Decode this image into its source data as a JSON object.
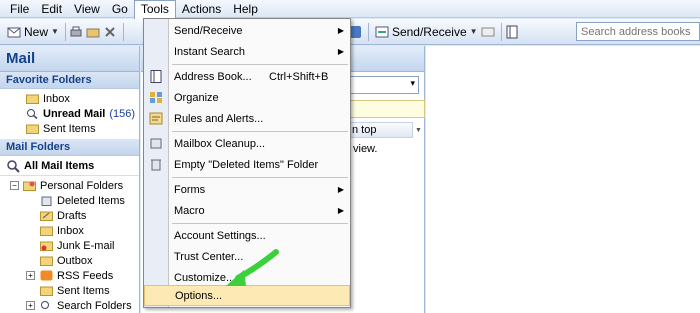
{
  "menubar": {
    "items": [
      "File",
      "Edit",
      "View",
      "Go",
      "Tools",
      "Actions",
      "Help"
    ]
  },
  "toolbar": {
    "new_label": "New",
    "send_receive_label": "Send/Receive",
    "search_placeholder": "Search address books"
  },
  "nav": {
    "title": "Mail",
    "favorites_header": "Favorite Folders",
    "favorites": [
      {
        "label": "Inbox"
      },
      {
        "label": "Unread Mail",
        "count": "(156)"
      },
      {
        "label": "Sent Items"
      }
    ],
    "mail_folders_header": "Mail Folders",
    "all_mail_label": "All Mail Items",
    "personal_folders_label": "Personal Folders",
    "folders": [
      "Deleted Items",
      "Drafts",
      "Inbox",
      "Junk E-mail",
      "Outbox",
      "RSS Feeds",
      "Sent Items",
      "Search Folders"
    ]
  },
  "list": {
    "column_header": "n top",
    "preview_text": "view."
  },
  "tools_menu": {
    "items": [
      {
        "label": "Send/Receive",
        "arrow": "▶"
      },
      {
        "label": "Instant Search",
        "arrow": "▶"
      },
      {
        "label": "Address Book...",
        "shortcut": "Ctrl+Shift+B"
      },
      {
        "label": "Organize"
      },
      {
        "label": "Rules and Alerts..."
      },
      {
        "label": "Mailbox Cleanup..."
      },
      {
        "label": "Empty \"Deleted Items\" Folder"
      },
      {
        "label": "Forms",
        "arrow": "▶"
      },
      {
        "label": "Macro",
        "arrow": "▶"
      },
      {
        "label": "Account Settings..."
      },
      {
        "label": "Trust Center..."
      },
      {
        "label": "Customize..."
      },
      {
        "label": "Options..."
      }
    ]
  },
  "colors": {
    "accent": "#15428b",
    "highlight": "#fde9b3",
    "arrow": "#3bd13b"
  }
}
